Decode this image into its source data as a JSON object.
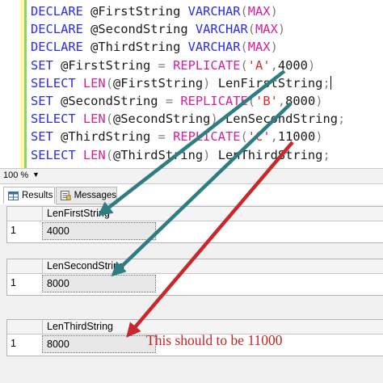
{
  "editor": {
    "lines": [
      [
        {
          "t": "DECLARE ",
          "c": "kw"
        },
        {
          "t": "@FirstString ",
          "c": "tx"
        },
        {
          "t": "VARCHAR",
          "c": "kw"
        },
        {
          "t": "(",
          "c": "gr"
        },
        {
          "t": "MAX",
          "c": "fn"
        },
        {
          "t": ")",
          "c": "gr"
        }
      ],
      [
        {
          "t": "DECLARE ",
          "c": "kw"
        },
        {
          "t": "@SecondString ",
          "c": "tx"
        },
        {
          "t": "VARCHAR",
          "c": "kw"
        },
        {
          "t": "(",
          "c": "gr"
        },
        {
          "t": "MAX",
          "c": "fn"
        },
        {
          "t": ")",
          "c": "gr"
        }
      ],
      [
        {
          "t": "DECLARE ",
          "c": "kw"
        },
        {
          "t": "@ThirdString ",
          "c": "tx"
        },
        {
          "t": "VARCHAR",
          "c": "kw"
        },
        {
          "t": "(",
          "c": "gr"
        },
        {
          "t": "MAX",
          "c": "fn"
        },
        {
          "t": ")",
          "c": "gr"
        }
      ],
      [
        {
          "t": "SET ",
          "c": "kw"
        },
        {
          "t": "@FirstString ",
          "c": "tx"
        },
        {
          "t": "= ",
          "c": "gr"
        },
        {
          "t": "REPLICATE",
          "c": "fn"
        },
        {
          "t": "(",
          "c": "gr"
        },
        {
          "t": "'A'",
          "c": "str"
        },
        {
          "t": ",",
          "c": "gr"
        },
        {
          "t": "4000",
          "c": "tx"
        },
        {
          "t": ")",
          "c": "gr"
        }
      ],
      [
        {
          "t": "SELECT ",
          "c": "kw"
        },
        {
          "t": "LEN",
          "c": "fn"
        },
        {
          "t": "(",
          "c": "gr"
        },
        {
          "t": "@FirstString",
          "c": "tx"
        },
        {
          "t": ") ",
          "c": "gr"
        },
        {
          "t": "LenFirstString",
          "c": "tx"
        },
        {
          "t": ";",
          "c": "gr"
        }
      ],
      [
        {
          "t": "SET ",
          "c": "kw"
        },
        {
          "t": "@SecondString ",
          "c": "tx"
        },
        {
          "t": "= ",
          "c": "gr"
        },
        {
          "t": "REPLICATE",
          "c": "fn"
        },
        {
          "t": "(",
          "c": "gr"
        },
        {
          "t": "'B'",
          "c": "str"
        },
        {
          "t": ",",
          "c": "gr"
        },
        {
          "t": "8000",
          "c": "tx"
        },
        {
          "t": ")",
          "c": "gr"
        }
      ],
      [
        {
          "t": "SELECT ",
          "c": "kw"
        },
        {
          "t": "LEN",
          "c": "fn"
        },
        {
          "t": "(",
          "c": "gr"
        },
        {
          "t": "@SecondString",
          "c": "tx"
        },
        {
          "t": ") ",
          "c": "gr"
        },
        {
          "t": "LenSecondString",
          "c": "tx"
        },
        {
          "t": ";",
          "c": "gr"
        }
      ],
      [
        {
          "t": "SET ",
          "c": "kw"
        },
        {
          "t": "@ThirdString ",
          "c": "tx"
        },
        {
          "t": "= ",
          "c": "gr"
        },
        {
          "t": "REPLICATE",
          "c": "fn"
        },
        {
          "t": "(",
          "c": "gr"
        },
        {
          "t": "'C'",
          "c": "str"
        },
        {
          "t": ",",
          "c": "gr"
        },
        {
          "t": "11000",
          "c": "tx"
        },
        {
          "t": ")",
          "c": "gr"
        }
      ],
      [
        {
          "t": "SELECT ",
          "c": "kw"
        },
        {
          "t": "LEN",
          "c": "fn"
        },
        {
          "t": "(",
          "c": "gr"
        },
        {
          "t": "@ThirdString",
          "c": "tx"
        },
        {
          "t": ") ",
          "c": "gr"
        },
        {
          "t": "LenThirdString",
          "c": "tx"
        },
        {
          "t": ";",
          "c": "gr"
        }
      ]
    ]
  },
  "zoom": {
    "value": "100 %",
    "arrow_icon": "dropdown-arrow-icon"
  },
  "tabs": {
    "results": {
      "label": "Results",
      "icon": "grid-icon"
    },
    "messages": {
      "label": "Messages",
      "icon": "messages-icon"
    }
  },
  "grids": [
    {
      "column": "LenFirstString",
      "row_number": "1",
      "value": "4000"
    },
    {
      "column": "LenSecondString",
      "row_number": "1",
      "value": "8000"
    },
    {
      "column": "LenThirdString",
      "row_number": "1",
      "value": "8000"
    }
  ],
  "annotation": {
    "text": "This should to be 11000"
  },
  "colors": {
    "arrow_teal": "#2f7d84",
    "arrow_red": "#c8282b",
    "annotation": "#cc2222"
  }
}
